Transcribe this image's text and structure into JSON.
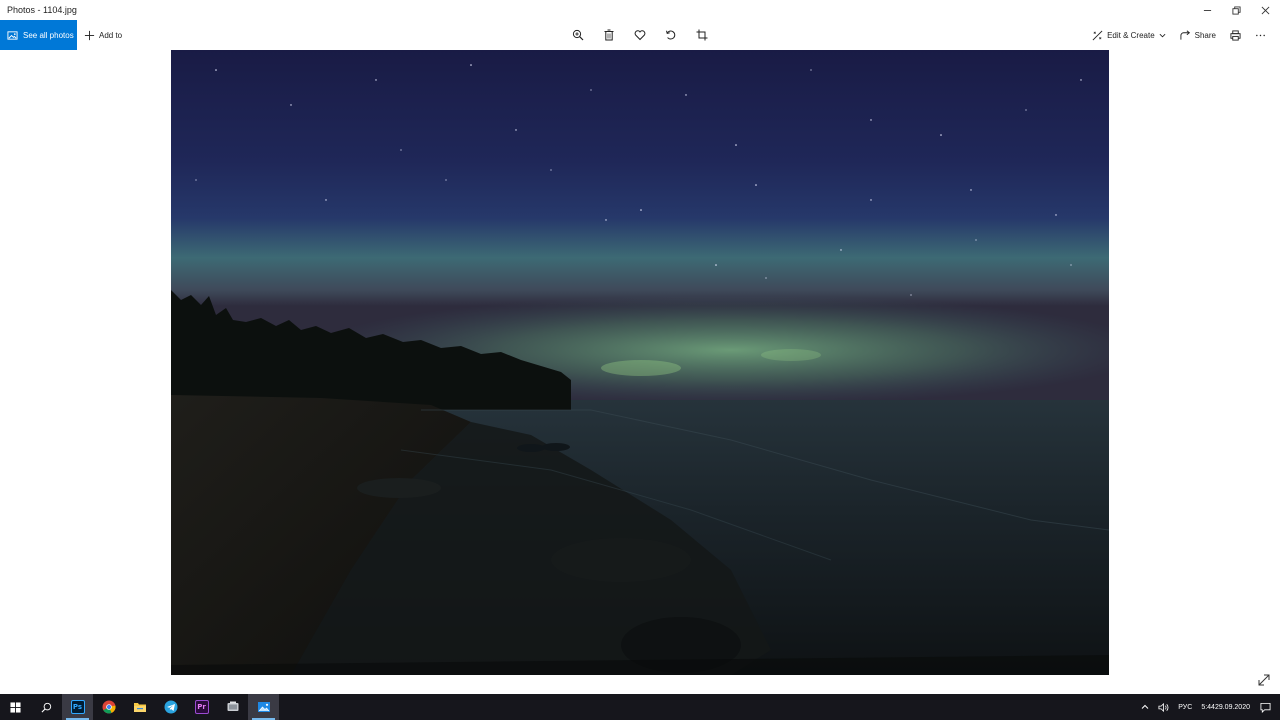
{
  "window": {
    "title": "Photos - 1104.jpg"
  },
  "toolbar": {
    "see_all_label": "See all photos",
    "add_to_label": "Add to",
    "edit_create_label": "Edit & Create",
    "share_label": "Share",
    "tools": [
      "zoom-icon",
      "delete-icon",
      "favorite-icon",
      "rotate-icon",
      "crop-icon"
    ]
  },
  "photo": {
    "subject": "aurora-lake-night"
  },
  "taskbar": {
    "apps": [
      "windows-start",
      "search",
      "photoshop",
      "chrome",
      "file-explorer",
      "telegram",
      "premiere-pro",
      "app-unknown",
      "photos"
    ],
    "photoshop_label": "Ps",
    "premiere_label": "Pr",
    "language": "РУС",
    "time": "5:44",
    "date": "29.09.2020"
  },
  "colors": {
    "accent": "#0078d7",
    "taskbar": "#16161c",
    "sky_top": "#1c1f4e",
    "aurora": "#5f9f7a"
  }
}
